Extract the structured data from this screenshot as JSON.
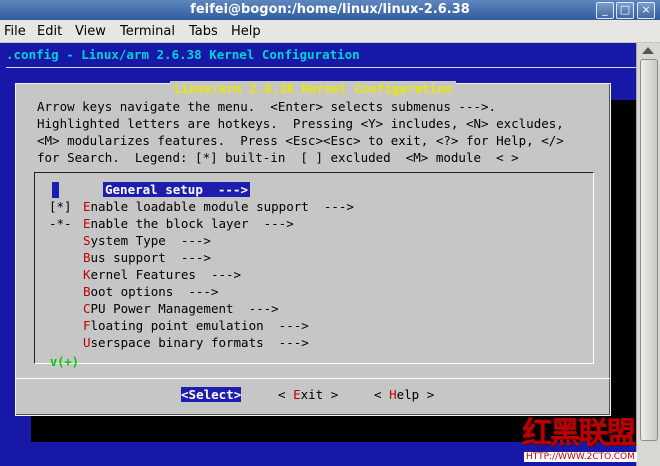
{
  "window": {
    "title": "feifei@bogon:/home/linux/linux-2.6.38",
    "buttons": {
      "minimize": "_",
      "maximize": "□",
      "close": "×"
    }
  },
  "menubar": {
    "items": [
      "File",
      "Edit",
      "View",
      "Terminal",
      "Tabs",
      "Help"
    ]
  },
  "terminal": {
    "config_title": ".config - Linux/arm 2.6.38 Kernel Configuration",
    "dialog": {
      "title": "Linux/arm 2.6.38 Kernel Configuration",
      "help_lines": [
        "Arrow keys navigate the menu.  <Enter> selects submenus --->.",
        "Highlighted letters are hotkeys.  Pressing <Y> includes, <N> excludes,",
        "<M> modularizes features.  Press <Esc><Esc> to exit, <?> for Help, </>",
        "for Search.  Legend: [*] built-in  [ ] excluded  <M> module  < >"
      ],
      "menu_items": [
        {
          "prefix": "",
          "hotkey": "G",
          "rest": "eneral setup  --->"
        },
        {
          "prefix": "[*]",
          "hotkey": "E",
          "rest": "nable loadable module support  --->"
        },
        {
          "prefix": "-*-",
          "hotkey": "E",
          "rest": "nable the block layer  --->"
        },
        {
          "prefix": "",
          "hotkey": "S",
          "rest": "ystem Type  --->"
        },
        {
          "prefix": "",
          "hotkey": "B",
          "rest": "us support  --->"
        },
        {
          "prefix": "",
          "hotkey": "K",
          "rest": "ernel Features  --->"
        },
        {
          "prefix": "",
          "hotkey": "B",
          "rest": "oot options  --->"
        },
        {
          "prefix": "",
          "hotkey": "C",
          "rest": "PU Power Management  --->"
        },
        {
          "prefix": "",
          "hotkey": "F",
          "rest": "loating point emulation  --->"
        },
        {
          "prefix": "",
          "hotkey": "U",
          "rest": "serspace binary formats  --->"
        }
      ],
      "scroll_indicator": "v(+)",
      "buttons": [
        {
          "open": "<",
          "hotkey": "S",
          "rest": "elect",
          "close": ">"
        },
        {
          "open": "< ",
          "hotkey": "E",
          "rest": "xit",
          "close": " >"
        },
        {
          "open": "< ",
          "hotkey": "H",
          "rest": "elp",
          "close": " >"
        }
      ]
    }
  },
  "watermark": {
    "logo": "红黑联盟",
    "url": "HTTP://WWW.2CTO.COM"
  }
}
